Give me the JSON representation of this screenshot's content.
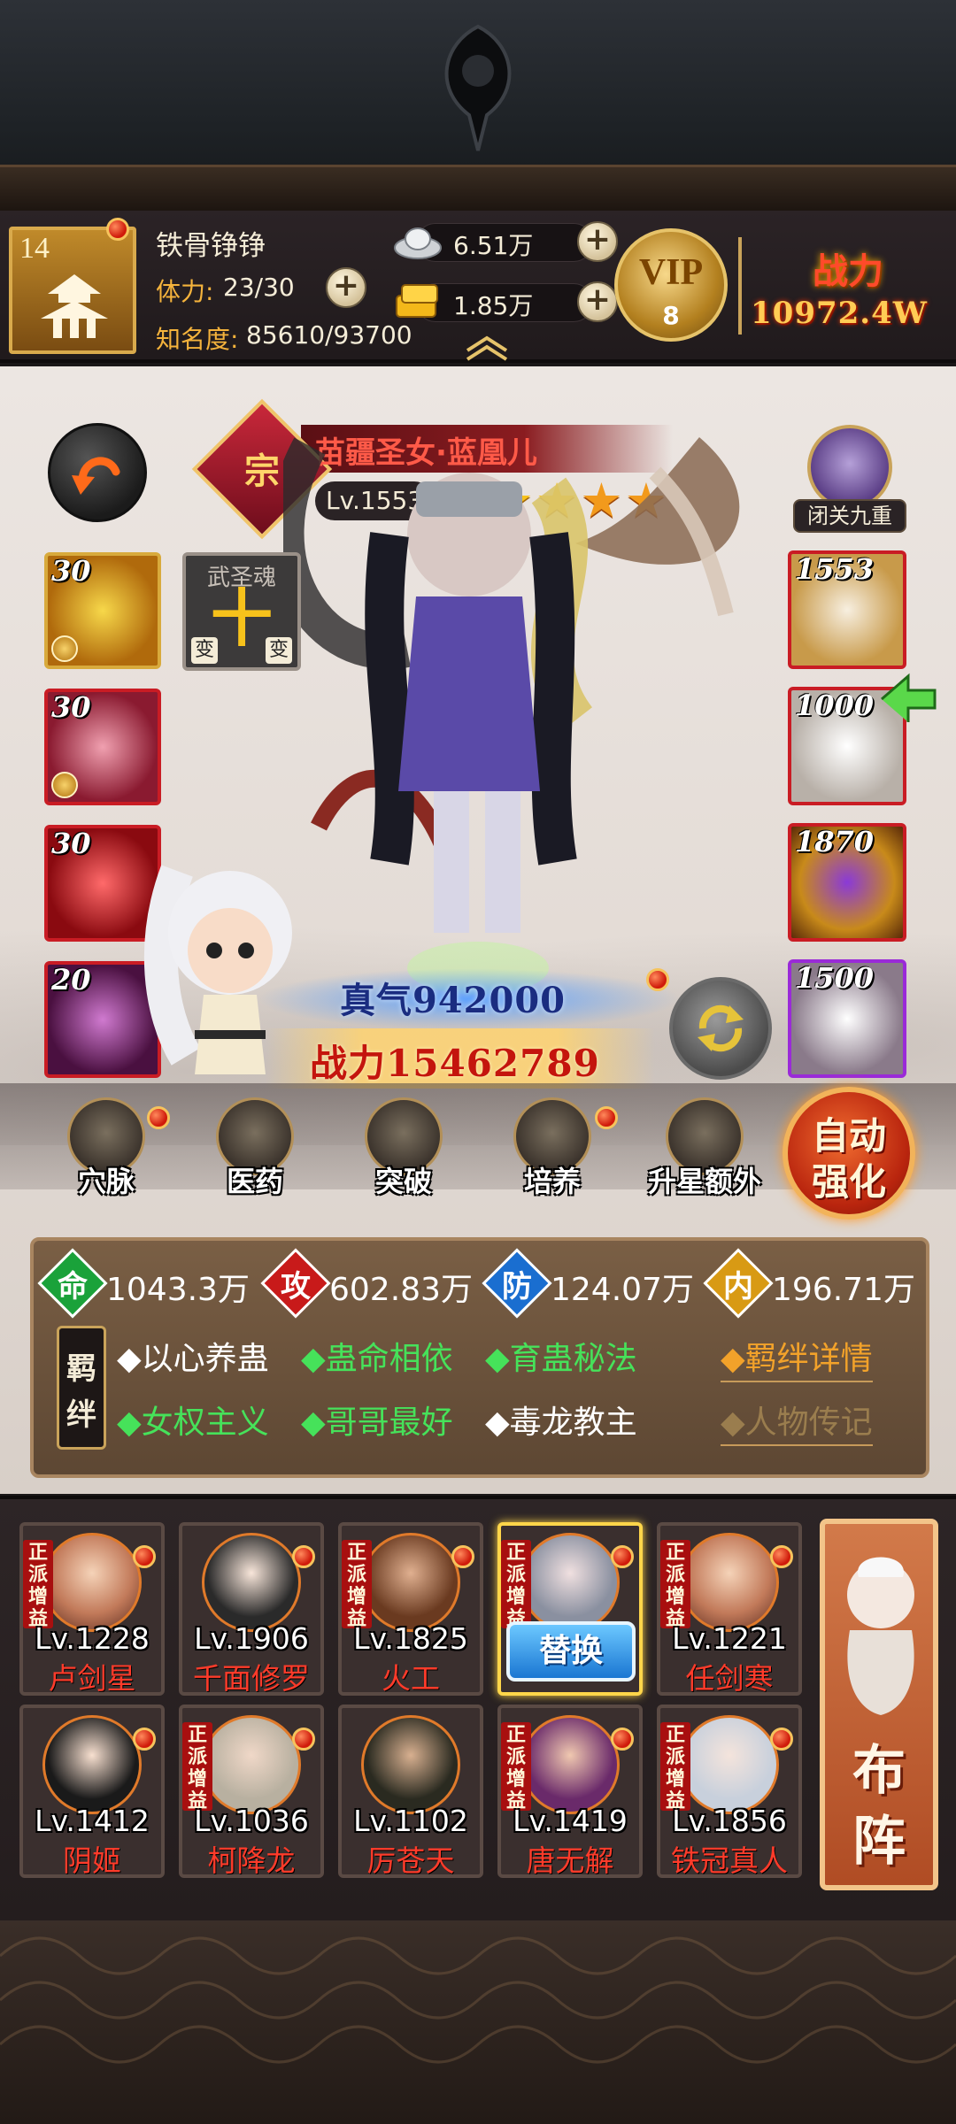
{
  "player": {
    "level": "14",
    "name": "铁骨铮铮",
    "stamina_label": "体力:",
    "stamina": "23/30",
    "fame_label": "知名度:",
    "fame": "85610/93700",
    "silver": "6.51万",
    "gold": "1.85万",
    "vip_label": "VIP",
    "vip_level": "8",
    "power_label": "战力",
    "power_value": "10972.4W"
  },
  "hero": {
    "badge": "宗",
    "name": "苗疆圣女·蓝凰儿",
    "level": "Lv.1553",
    "stars": 5,
    "seclusion_label": "闭关九重",
    "spirit_title": "武圣魂",
    "spirit_char": "十",
    "spirit_left": "变",
    "spirit_right": "变",
    "true_qi": "真气942000",
    "combat_power": "战力15462789"
  },
  "skills": [
    {
      "level": "30"
    },
    {
      "level": "30"
    },
    {
      "level": "30"
    },
    {
      "level": "20"
    }
  ],
  "equipment": [
    {
      "level": "1553"
    },
    {
      "level": "1000"
    },
    {
      "level": "1870"
    },
    {
      "level": "1500"
    }
  ],
  "functions": [
    {
      "label": "穴脉"
    },
    {
      "label": "医药"
    },
    {
      "label": "突破"
    },
    {
      "label": "培养"
    },
    {
      "label": "升星额外"
    }
  ],
  "auto_enhance": {
    "line1": "自动",
    "line2": "强化"
  },
  "stats": [
    {
      "icon": "命",
      "value": "1043.3万",
      "color": "#1aa23a"
    },
    {
      "icon": "攻",
      "value": "602.83万",
      "color": "#c81a1a"
    },
    {
      "icon": "防",
      "value": "124.07万",
      "color": "#1a6ed0"
    },
    {
      "icon": "内",
      "value": "196.71万",
      "color": "#d89a14"
    }
  ],
  "bond_tag": {
    "t1": "羁",
    "t2": "绊"
  },
  "bonds": [
    {
      "text": "◆以心养蛊",
      "color": "white"
    },
    {
      "text": "◆蛊命相依",
      "color": "green"
    },
    {
      "text": "◆育蛊秘法",
      "color": "green"
    },
    {
      "text": "◆女权主义",
      "color": "green"
    },
    {
      "text": "◆哥哥最好",
      "color": "green"
    },
    {
      "text": "◆毒龙教主",
      "color": "white"
    }
  ],
  "links": {
    "bond_detail": "◆羁绊详情",
    "biography": "◆人物传记"
  },
  "lineup": [
    {
      "level": "Lv.1228",
      "name": "卢剑星",
      "faction": "正派增益"
    },
    {
      "level": "Lv.1906",
      "name": "千面修罗",
      "faction": ""
    },
    {
      "level": "Lv.1825",
      "name": "火工",
      "faction": "正派增益"
    },
    {
      "level": "",
      "name": "",
      "faction": "正派增益",
      "replace": "替换"
    },
    {
      "level": "Lv.1221",
      "name": "任剑寒",
      "faction": "正派增益"
    },
    {
      "level": "Lv.1412",
      "name": "阴姬",
      "faction": ""
    },
    {
      "level": "Lv.1036",
      "name": "柯降龙",
      "faction": "正派增益"
    },
    {
      "level": "Lv.1102",
      "name": "厉苍天",
      "faction": ""
    },
    {
      "level": "Lv.1419",
      "name": "唐无解",
      "faction": "正派增益"
    },
    {
      "level": "Lv.1856",
      "name": "铁冠真人",
      "faction": "正派增益"
    }
  ],
  "formation": {
    "l1": "布",
    "l2": "阵"
  }
}
